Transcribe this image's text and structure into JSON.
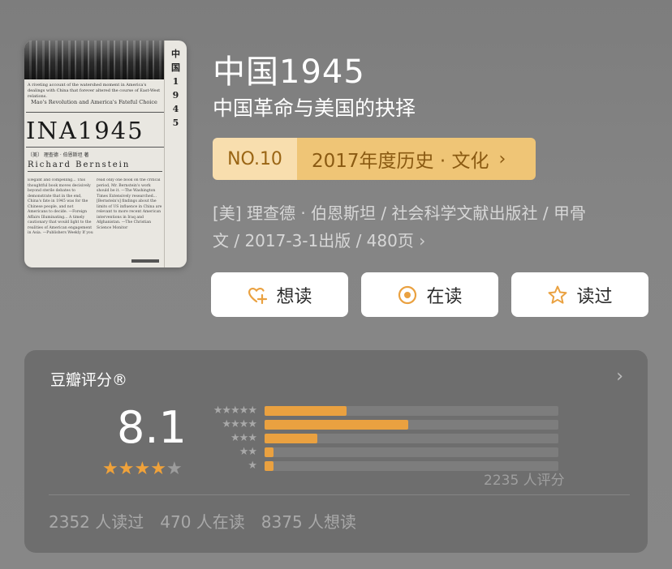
{
  "book": {
    "title": "中国1945",
    "subtitle": "中国革命与美国的抉择",
    "meta_line1": "[美] 理查德 · 伯恩斯坦 / 社会科学文献出版社 / 甲骨",
    "meta_line2": "文 / 2017-3-1出版 / 480页"
  },
  "cover": {
    "side_text": [
      "中",
      "国",
      "1",
      "9",
      "4",
      "5"
    ],
    "blurb": "A riveting account of the watershed moment in America's dealings with China that forever altered the course of East-West relations.",
    "subtitle": "Mao's Revolution and America's Fateful Choice",
    "title_text": "INA1945",
    "author_line": "〔美〕 理查德 · 伯恩斯坦  著",
    "author_en": "Richard Bernstein",
    "body": "Elegant and compelling... This thoughtful book moves decisively beyond sterile debates to demonstrate that in the end, China's fate in 1945 was for the Chinese people, and not Americans to decide. —Foreign Affairs  Illuminating... A timely cautionary that would light to the realities of American engagement in Asia. —Publishers Weekly  If you read only one book on the critical period, Mr. Bernstein's work should be it. —The Washington Times  Extensively researched... [Bernstein's] findings about the limits of US influence in China are relevant to more recent American interventions in Iraq and Afghanistan. —The Christian Science Monitor"
  },
  "ranking": {
    "number": "NO.10",
    "label": "2017年度历史 · 文化"
  },
  "actions": [
    {
      "label": "想读",
      "icon": "heart-plus-icon"
    },
    {
      "label": "在读",
      "icon": "reading-dot-icon"
    },
    {
      "label": "读过",
      "icon": "star-outline-icon"
    }
  ],
  "rating": {
    "label": "豆瓣评分®",
    "score": "8.1",
    "stars": 4,
    "max_stars": 5,
    "count_text": "2235 人评分",
    "distribution": [
      {
        "stars": 5,
        "fraction": 0.28
      },
      {
        "stars": 4,
        "fraction": 0.49
      },
      {
        "stars": 3,
        "fraction": 0.18
      },
      {
        "stars": 2,
        "fraction": 0.03
      },
      {
        "stars": 1,
        "fraction": 0.03
      }
    ],
    "stats": [
      "2352 人读过",
      "470 人在读",
      "8375 人想读"
    ]
  },
  "colors": {
    "accent": "#eaa140",
    "rank_bg": "#efc576",
    "rank_text": "#8a5a12"
  }
}
